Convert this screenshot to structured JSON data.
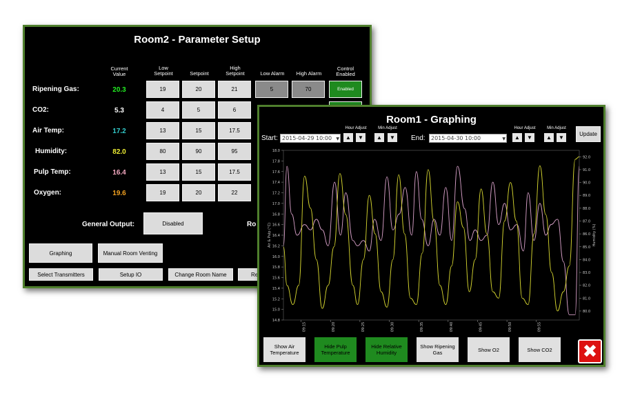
{
  "room2": {
    "title": "Room2 - Parameter Setup",
    "headers": {
      "current": "Current\nValue",
      "low_setpoint": "Low\nSetpoint",
      "setpoint": "Setpoint",
      "high_setpoint": "High\nSetpoint",
      "low_alarm": "Low Alarm",
      "high_alarm": "High Alarm",
      "control": "Control\nEnabled"
    },
    "rows": [
      {
        "label": "Ripening Gas:",
        "current": "20.3",
        "color": "#22ee22",
        "low": "19",
        "set": "20",
        "high": "21",
        "low_alarm": "5",
        "high_alarm": "70",
        "control": "Enabled"
      },
      {
        "label": "CO2:",
        "current": "5.3",
        "color": "#ffffff",
        "low": "4",
        "set": "5",
        "high": "6"
      },
      {
        "label": "Air Temp:",
        "current": "17.2",
        "color": "#33cccc",
        "low": "13",
        "set": "15",
        "high": "17.5"
      },
      {
        "label": "Humidity:",
        "current": "82.0",
        "color": "#eeee33",
        "low": "80",
        "set": "90",
        "high": "95"
      },
      {
        "label": "Pulp Temp:",
        "current": "16.4",
        "color": "#f4a8c0",
        "low": "13",
        "set": "15",
        "high": "17.5"
      },
      {
        "label": "Oxygen:",
        "current": "19.6",
        "color": "#f0a020",
        "low": "19",
        "set": "20",
        "high": "22"
      }
    ],
    "general_output_label": "General Output:",
    "general_output_value": "Disabled",
    "room_label_partial": "Ro",
    "buttons": {
      "graphing": "Graphing",
      "manual_venting": "Manual Room Venting",
      "select_transmitters": "Select Transmitters",
      "setup_io": "Setup IO",
      "change_room_name": "Change Room Name",
      "partial": "Re"
    }
  },
  "room1": {
    "title": "Room1 - Graphing",
    "start_label": "Start:",
    "start_value": "2015-04-29  10:00",
    "end_label": "End:",
    "end_value": "2015-04-30  10:00",
    "hour_adjust": "Hour Adjust",
    "min_adjust": "Min Adjust",
    "update": "Update",
    "buttons": [
      {
        "label": "Show Air Temperature",
        "on": false
      },
      {
        "label": "Hide Pulp Temperature",
        "on": true
      },
      {
        "label": "Hide Relative Humidity",
        "on": true
      },
      {
        "label": "Show Ripening Gas",
        "on": false
      },
      {
        "label": "Show O2",
        "on": false
      },
      {
        "label": "Show CO2",
        "on": false
      }
    ]
  },
  "chart_data": {
    "type": "line",
    "title": "",
    "xlabel": "",
    "ylabel": "Air & Pulp (°C)",
    "y2label": "Humidity (%)",
    "x_ticks": [
      "09:15",
      "09:20",
      "09:25",
      "09:30",
      "09:35",
      "09:40",
      "09:45",
      "09:50",
      "09:55"
    ],
    "ylim": [
      14.8,
      18.0
    ],
    "y_ticks": [
      "18.0",
      "17.8",
      "17.6",
      "17.4",
      "17.2",
      "17.0",
      "16.8",
      "16.6",
      "16.4",
      "16.2",
      "16.0",
      "15.8",
      "15.6",
      "15.4",
      "15.2",
      "15.0",
      "14.8"
    ],
    "y2lim": [
      79.3,
      92.5
    ],
    "y2_ticks": [
      "92.0",
      "91.0",
      "90.0",
      "89.0",
      "88.0",
      "87.0",
      "86.0",
      "85.0",
      "84.0",
      "83.0",
      "82.0",
      "81.0",
      "80.0"
    ],
    "grid": false,
    "series": [
      {
        "name": "Pulp Temperature",
        "color": "#d8a0c8",
        "axis": "left",
        "x": [
          12.0,
          12.6,
          13.4,
          14.3,
          15.6,
          16.6,
          17.6,
          18.6,
          19.6,
          20.7,
          21.7,
          22.6,
          23.8,
          24.6,
          25.6,
          26.6,
          27.5,
          28.6,
          29.6,
          30.6,
          31.7,
          32.7,
          33.8,
          34.6,
          35.5,
          36.6,
          37.6,
          38.6,
          39.6,
          40.6,
          41.6,
          42.8,
          43.7,
          44.6,
          45.6,
          46.6,
          47.6,
          48.6,
          49.6,
          50.6,
          51.7,
          52.8,
          53.6,
          54.6,
          55.6,
          56.6,
          57.5,
          58.6,
          59.6,
          60.6,
          61.6,
          62.3
        ],
        "y": [
          16.2,
          17.7,
          16.8,
          16.4,
          16.6,
          16.5,
          16.7,
          16.5,
          16.2,
          17.4,
          16.4,
          17.2,
          16.3,
          16.2,
          16.3,
          16.1,
          16.7,
          16.3,
          17.5,
          16.5,
          16.8,
          17.3,
          16.4,
          17.6,
          16.7,
          16.2,
          16.7,
          16.4,
          17.3,
          16.3,
          17.7,
          16.9,
          16.3,
          16.5,
          16.3,
          16.4,
          17.4,
          16.6,
          17.0,
          16.5,
          16.6,
          16.1,
          17.2,
          16.3,
          17.0,
          16.4,
          16.6,
          16.7,
          15.9,
          14.9,
          14.9,
          17.7
        ]
      },
      {
        "name": "Relative Humidity",
        "color": "#d8d830",
        "axis": "right",
        "x": [
          12.0,
          12.6,
          13.6,
          14.6,
          15.6,
          16.6,
          17.6,
          18.6,
          19.6,
          20.6,
          21.6,
          22.6,
          23.8,
          24.6,
          25.6,
          26.6,
          27.6,
          28.6,
          29.6,
          30.6,
          31.6,
          32.6,
          33.6,
          34.6,
          35.6,
          36.6,
          37.6,
          38.6,
          39.6,
          40.6,
          41.6,
          42.6,
          43.6,
          44.6,
          45.6,
          46.6,
          47.6,
          48.6,
          49.6,
          50.6,
          51.6,
          52.6,
          53.6,
          54.6,
          55.6,
          56.6,
          57.6,
          58.6,
          59.6,
          60.6,
          61.6,
          62.3
        ],
        "y": [
          85.0,
          82.0,
          80.5,
          82.0,
          90.5,
          88.0,
          84.0,
          80.2,
          82.0,
          85.0,
          90.7,
          87.5,
          82.0,
          80.5,
          84.0,
          89.0,
          86.0,
          81.5,
          80.3,
          84.0,
          90.6,
          86.0,
          81.0,
          80.5,
          84.5,
          91.0,
          87.0,
          82.0,
          80.5,
          83.5,
          88.5,
          86.5,
          81.5,
          84.0,
          89.5,
          86.0,
          81.5,
          81.0,
          87.0,
          90.0,
          87.0,
          81.0,
          80.5,
          86.0,
          91.3,
          87.5,
          83.0,
          80.0,
          81.5,
          83.5,
          91.8,
          92.0
        ]
      }
    ]
  }
}
